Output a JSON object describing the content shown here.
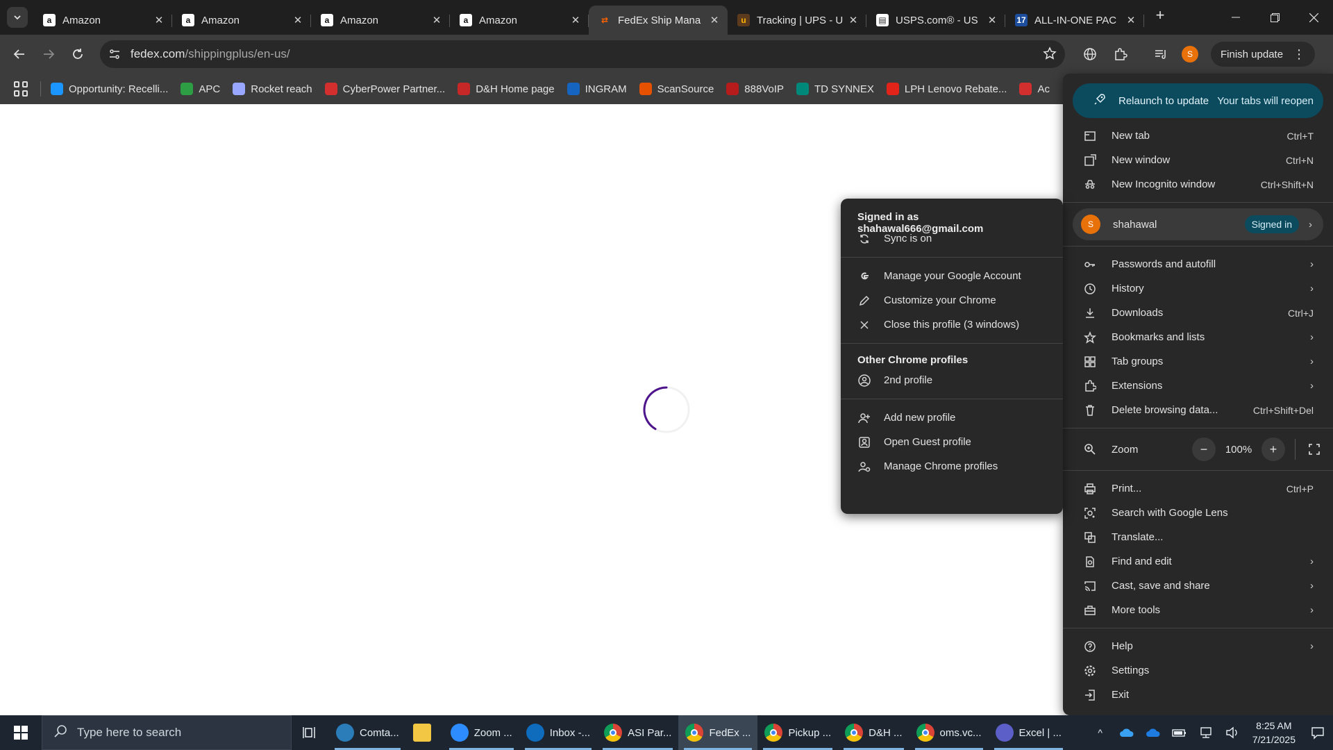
{
  "tabs": [
    {
      "title": "Amazon",
      "favicon": "amazon-icon",
      "active": false
    },
    {
      "title": "Amazon",
      "favicon": "amazon-icon",
      "active": false
    },
    {
      "title": "Amazon",
      "favicon": "amazon-icon",
      "active": false
    },
    {
      "title": "Amazon",
      "favicon": "amazon-icon",
      "active": false
    },
    {
      "title": "FedEx Ship Mana",
      "favicon": "fedex-icon",
      "active": true
    },
    {
      "title": "Tracking | UPS - U",
      "favicon": "ups-icon",
      "active": false
    },
    {
      "title": "USPS.com® - US",
      "favicon": "usps-icon",
      "active": false
    },
    {
      "title": "ALL-IN-ONE PAC",
      "favicon": "17track-icon",
      "active": false
    }
  ],
  "toolbar": {
    "url_host": "fedex.com",
    "url_path": "/shippingplus/en-us/",
    "avatar_letter": "S",
    "finish_update_label": "Finish update"
  },
  "bookmarks": [
    {
      "label": "Opportunity: Recelli...",
      "icon": "salesforce-cloud-icon",
      "color": "#1b96ff"
    },
    {
      "label": "APC",
      "icon": "apc-icon",
      "color": "#2e9e44"
    },
    {
      "label": "Rocket reach",
      "icon": "rocket-icon",
      "color": "#9aa7ff"
    },
    {
      "label": "CyberPower Partner...",
      "icon": "cyberpower-icon",
      "color": "#d32f2f"
    },
    {
      "label": "D&H Home page",
      "icon": "dh-icon",
      "color": "#c62828"
    },
    {
      "label": "INGRAM",
      "icon": "ingram-icon",
      "color": "#1565c0"
    },
    {
      "label": "ScanSource",
      "icon": "scansource-icon",
      "color": "#e65100"
    },
    {
      "label": "888VoIP",
      "icon": "888voip-icon",
      "color": "#b71c1c"
    },
    {
      "label": "TD SYNNEX",
      "icon": "tdsynnex-icon",
      "color": "#00897b"
    },
    {
      "label": "LPH Lenovo Rebate...",
      "icon": "lenovo-icon",
      "color": "#e2231a"
    },
    {
      "label": "Ac",
      "icon": "acrobat-icon",
      "color": "#d32f2f"
    }
  ],
  "chrome_menu": {
    "relaunch_label": "Relaunch to update",
    "relaunch_sub": "Your tabs will reopen",
    "group1": [
      {
        "label": "New tab",
        "shortcut": "Ctrl+T",
        "icon": "new-tab-icon"
      },
      {
        "label": "New window",
        "shortcut": "Ctrl+N",
        "icon": "new-window-icon"
      },
      {
        "label": "New Incognito window",
        "shortcut": "Ctrl+Shift+N",
        "icon": "incognito-icon"
      }
    ],
    "profile": {
      "name": "shahawal",
      "badge": "Signed in",
      "letter": "S"
    },
    "group2": [
      {
        "label": "Passwords and autofill",
        "shortcut": "",
        "chevron": true,
        "icon": "key-icon"
      },
      {
        "label": "History",
        "shortcut": "",
        "chevron": true,
        "icon": "history-icon"
      },
      {
        "label": "Downloads",
        "shortcut": "Ctrl+J",
        "chevron": false,
        "icon": "download-icon"
      },
      {
        "label": "Bookmarks and lists",
        "shortcut": "",
        "chevron": true,
        "icon": "star-icon"
      },
      {
        "label": "Tab groups",
        "shortcut": "",
        "chevron": true,
        "icon": "tab-groups-icon"
      },
      {
        "label": "Extensions",
        "shortcut": "",
        "chevron": true,
        "icon": "extensions-icon"
      },
      {
        "label": "Delete browsing data...",
        "shortcut": "Ctrl+Shift+Del",
        "chevron": false,
        "icon": "trash-icon"
      }
    ],
    "zoom": {
      "label": "Zoom",
      "value": "100%",
      "minus": "−",
      "plus": "+"
    },
    "group3": [
      {
        "label": "Print...",
        "shortcut": "Ctrl+P",
        "chevron": false,
        "icon": "print-icon"
      },
      {
        "label": "Search with Google Lens",
        "shortcut": "",
        "chevron": false,
        "icon": "lens-icon"
      },
      {
        "label": "Translate...",
        "shortcut": "",
        "chevron": false,
        "icon": "translate-icon"
      },
      {
        "label": "Find and edit",
        "shortcut": "",
        "chevron": true,
        "icon": "find-icon"
      },
      {
        "label": "Cast, save and share",
        "shortcut": "",
        "chevron": true,
        "icon": "cast-icon"
      },
      {
        "label": "More tools",
        "shortcut": "",
        "chevron": true,
        "icon": "toolbox-icon"
      }
    ],
    "group4": [
      {
        "label": "Help",
        "shortcut": "",
        "chevron": true,
        "icon": "help-icon"
      },
      {
        "label": "Settings",
        "shortcut": "",
        "chevron": false,
        "icon": "settings-icon"
      },
      {
        "label": "Exit",
        "shortcut": "",
        "chevron": false,
        "icon": "exit-icon"
      }
    ]
  },
  "profile_menu": {
    "signed_in_as": "Signed in as shahawal666@gmail.com",
    "sync": "Sync is on",
    "account_items": [
      {
        "label": "Manage your Google Account",
        "icon": "google-icon"
      },
      {
        "label": "Customize your Chrome",
        "icon": "pencil-icon"
      },
      {
        "label": "Close this profile (3 windows)",
        "icon": "close-icon"
      }
    ],
    "other_profiles_heading": "Other Chrome profiles",
    "other_profiles": [
      {
        "label": "2nd profile",
        "icon": "person-circle-icon"
      }
    ],
    "manage_items": [
      {
        "label": "Add new profile",
        "icon": "add-person-icon"
      },
      {
        "label": "Open Guest profile",
        "icon": "guest-icon"
      },
      {
        "label": "Manage Chrome profiles",
        "icon": "manage-profiles-icon"
      }
    ]
  },
  "taskbar": {
    "search_placeholder": "Type here to search",
    "apps": [
      {
        "label": "Comta...",
        "icon": "comtas-icon",
        "color": "#2a7db8",
        "running": true,
        "active": false
      },
      {
        "label": "",
        "icon": "file-explorer-icon",
        "color": "#f2c744",
        "running": false,
        "active": false
      },
      {
        "label": "Zoom ...",
        "icon": "zoom-icon",
        "color": "#2d8cff",
        "running": true,
        "active": false
      },
      {
        "label": "Inbox -...",
        "icon": "outlook-icon",
        "color": "#0f6cbd",
        "running": true,
        "active": false
      },
      {
        "label": "ASI Par...",
        "icon": "chrome-icon",
        "color": "#db4437",
        "running": true,
        "active": false
      },
      {
        "label": "FedEx ...",
        "icon": "chrome-icon",
        "color": "#db4437",
        "running": true,
        "active": true
      },
      {
        "label": "Pickup ...",
        "icon": "chrome-icon",
        "color": "#db4437",
        "running": true,
        "active": false
      },
      {
        "label": "D&H ...",
        "icon": "chrome-icon",
        "color": "#db4437",
        "running": true,
        "active": false
      },
      {
        "label": "oms.vc...",
        "icon": "chrome-icon",
        "color": "#db4437",
        "running": true,
        "active": false
      },
      {
        "label": "Excel | ...",
        "icon": "teams-icon",
        "color": "#5b5fc7",
        "running": true,
        "active": false
      }
    ],
    "time": "8:25 AM",
    "date": "7/21/2025"
  }
}
